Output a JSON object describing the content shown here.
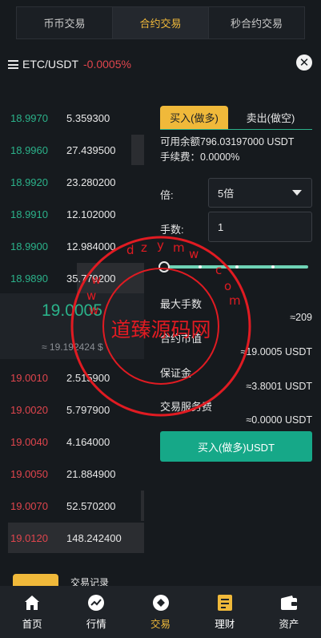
{
  "top_tabs": [
    {
      "label": "币币交易",
      "active": false
    },
    {
      "label": "合约交易",
      "active": true
    },
    {
      "label": "秒合约交易",
      "active": false
    }
  ],
  "pair": {
    "name": "ETC/USDT",
    "change": "-0.0005%"
  },
  "orderbook": {
    "asks": [
      {
        "price": "18.9970",
        "qty": "5.359300"
      },
      {
        "price": "18.9960",
        "qty": "27.439500"
      },
      {
        "price": "18.9920",
        "qty": "23.280200"
      },
      {
        "price": "18.9910",
        "qty": "12.102000"
      },
      {
        "price": "18.9900",
        "qty": "12.984000"
      },
      {
        "price": "18.9890",
        "qty": "35.779200"
      }
    ],
    "last_price": "19.0005",
    "last_price_usd": "≈ 19.192424 $",
    "bids": [
      {
        "price": "19.0010",
        "qty": "2.515900"
      },
      {
        "price": "19.0020",
        "qty": "5.797900"
      },
      {
        "price": "19.0040",
        "qty": "4.164000"
      },
      {
        "price": "19.0050",
        "qty": "21.884900"
      },
      {
        "price": "19.0070",
        "qty": "52.570200"
      },
      {
        "price": "19.0120",
        "qty": "148.242400"
      }
    ]
  },
  "order_form": {
    "tabs": [
      "买入(做多)",
      "卖出(做空)"
    ],
    "available": "可用余额796.03197000 USDT",
    "fee_rate": "手续费：0.0000%",
    "leverage_label": "倍:",
    "leverage_value": "5倍",
    "lots_label": "手数:",
    "lots_value": "1",
    "slider_value_percent": 0
  },
  "stats": [
    {
      "label": "最大手数",
      "value": "≈209"
    },
    {
      "label": "合约市值",
      "value": "≈19.0005 USDT"
    },
    {
      "label": "保证金",
      "value": "≈3.8001 USDT"
    },
    {
      "label": "交易服务费",
      "value": "≈0.0000 USDT"
    }
  ],
  "submit_label": "买入(做多)USDT",
  "lower_tabs": {
    "second": "交易记录"
  },
  "watermark": {
    "text": "道臻源码网",
    "ring_text": "dzymw.com"
  },
  "bottom_nav": [
    {
      "label": "首页",
      "icon": "home-icon",
      "active": false
    },
    {
      "label": "行情",
      "icon": "market-chart-icon",
      "active": false
    },
    {
      "label": "交易",
      "icon": "trade-icon",
      "active": true
    },
    {
      "label": "理财",
      "icon": "finance-icon",
      "active": false
    },
    {
      "label": "资产",
      "icon": "wallet-icon",
      "active": false
    }
  ],
  "colors": {
    "accent": "#f0b93a",
    "up": "#2bb28a",
    "down": "#e0454d",
    "button": "#16a888"
  }
}
